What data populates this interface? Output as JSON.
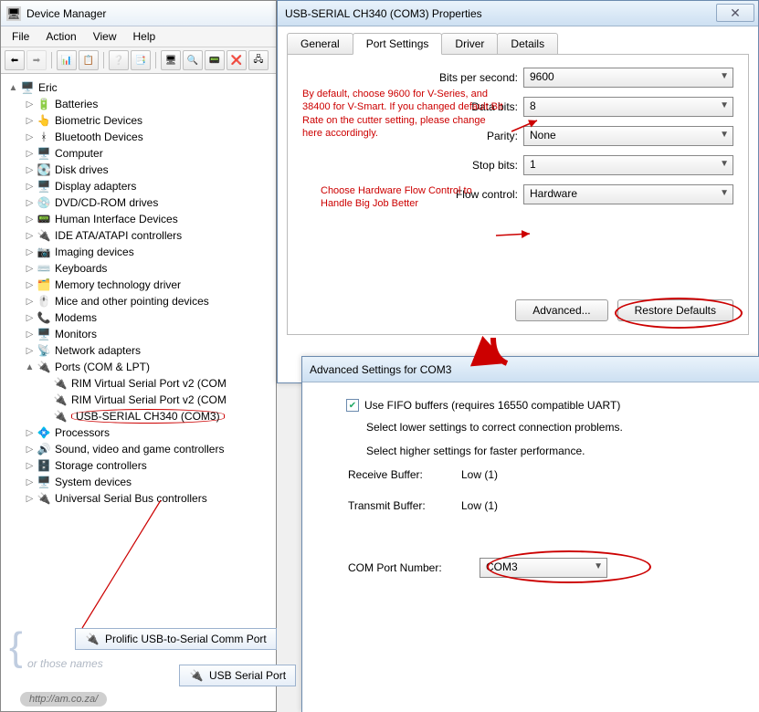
{
  "devmgr": {
    "title": "Device Manager",
    "menu": [
      "File",
      "Action",
      "View",
      "Help"
    ],
    "root": "Eric",
    "nodes": [
      {
        "icon": "🔋",
        "label": "Batteries"
      },
      {
        "icon": "👆",
        "label": "Biometric Devices"
      },
      {
        "icon": "ᚼ",
        "label": "Bluetooth Devices"
      },
      {
        "icon": "🖥️",
        "label": "Computer"
      },
      {
        "icon": "💽",
        "label": "Disk drives"
      },
      {
        "icon": "🖥️",
        "label": "Display adapters"
      },
      {
        "icon": "💿",
        "label": "DVD/CD-ROM drives"
      },
      {
        "icon": "📟",
        "label": "Human Interface Devices"
      },
      {
        "icon": "🔌",
        "label": "IDE ATA/ATAPI controllers"
      },
      {
        "icon": "📷",
        "label": "Imaging devices"
      },
      {
        "icon": "⌨️",
        "label": "Keyboards"
      },
      {
        "icon": "🗂️",
        "label": "Memory technology driver"
      },
      {
        "icon": "🖱️",
        "label": "Mice and other pointing devices"
      },
      {
        "icon": "📞",
        "label": "Modems"
      },
      {
        "icon": "🖥️",
        "label": "Monitors"
      },
      {
        "icon": "📡",
        "label": "Network adapters"
      }
    ],
    "ports": {
      "icon": "🔌",
      "label": "Ports (COM & LPT)"
    },
    "ports_children": [
      {
        "icon": "🔌",
        "label": "RIM Virtual Serial Port v2 (COM"
      },
      {
        "icon": "🔌",
        "label": "RIM Virtual Serial Port v2 (COM"
      },
      {
        "icon": "🔌",
        "label": "USB-SERIAL CH340 (COM3)"
      }
    ],
    "nodes_after": [
      {
        "icon": "💠",
        "label": "Processors"
      },
      {
        "icon": "🔊",
        "label": "Sound, video and game controllers"
      },
      {
        "icon": "🗄️",
        "label": "Storage controllers"
      },
      {
        "icon": "🖥️",
        "label": "System devices"
      },
      {
        "icon": "🔌",
        "label": "Universal Serial Bus controllers"
      }
    ],
    "stray1": "Prolific USB-to-Serial Comm Port",
    "stray2": "USB Serial Port",
    "orthose": "or those names",
    "url": "http://am.co.za/"
  },
  "props": {
    "title": "USB-SERIAL CH340 (COM3) Properties",
    "tabs": [
      "General",
      "Port Settings",
      "Driver",
      "Details"
    ],
    "fields": {
      "bps_label": "Bits per second:",
      "bps_value": "9600",
      "databits_label": "Data bits:",
      "databits_value": "8",
      "parity_label": "Parity:",
      "parity_value": "None",
      "stopbits_label": "Stop bits:",
      "stopbits_value": "1",
      "flow_label": "Flow control:",
      "flow_value": "Hardware"
    },
    "note1": "By default, choose 9600 for V-Series, and 38400 for V-Smart.\nIf you changed default Bit Rate on the cutter setting, please change here accordingly.",
    "note2": "Choose Hardware Flow Control to Handle Big Job Better",
    "advanced_btn": "Advanced...",
    "restore_btn": "Restore Defaults"
  },
  "adv": {
    "title": "Advanced Settings for COM3",
    "fifo_label": "Use FIFO buffers (requires 16550 compatible UART)",
    "hint_low": "Select lower settings to correct connection problems.",
    "hint_high": "Select higher settings for faster performance.",
    "rx_label": "Receive Buffer:",
    "rx_low": "Low (1)",
    "tx_label": "Transmit Buffer:",
    "tx_low": "Low (1)",
    "comport_label": "COM Port Number:",
    "comport_value": "COM3"
  }
}
